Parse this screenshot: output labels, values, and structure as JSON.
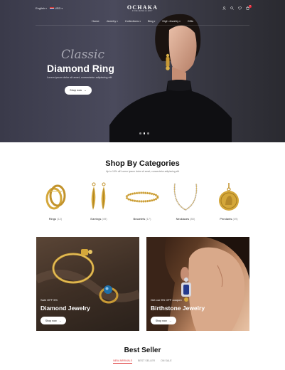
{
  "header": {
    "language": "English",
    "currency": "USD",
    "logo": "OCHAKA",
    "logo_tagline": "FINEJEWELLERY",
    "cart_count": "0",
    "nav": [
      "Home",
      "Jewelry",
      "Collections",
      "Blog",
      "High Jewelry",
      "Gifts"
    ]
  },
  "hero": {
    "script": "Classic",
    "title": "Diamond Ring",
    "subtitle": "Lorem ipsum dolor sit amet, consectetur adipiscing elit",
    "button": "Shop now",
    "slide_count": 3,
    "active_slide": 1
  },
  "categories": {
    "title": "Shop By Categories",
    "subtitle": "Up to 10% off Lorem ipsum dolor sit amet, consectetur adipiscing elit",
    "items": [
      {
        "label": "Rings",
        "count": "(12)",
        "icon": "ring-icon"
      },
      {
        "label": "Earrings",
        "count": "(49)",
        "icon": "earrings-icon"
      },
      {
        "label": "Bracelets",
        "count": "(17)",
        "icon": "bracelet-icon"
      },
      {
        "label": "Necklaces",
        "count": "(80)",
        "icon": "necklace-icon"
      },
      {
        "label": "Pendants",
        "count": "(49)",
        "icon": "pendant-icon"
      }
    ]
  },
  "banners": [
    {
      "offer": "Sale OFF 5%",
      "title": "Diamond Jewelry",
      "button": "Shop now"
    },
    {
      "offer": "Get our 5% OFF coupon",
      "title": "Birthstone Jewelry",
      "button": "Shop now"
    }
  ],
  "best_seller": {
    "title": "Best Seller",
    "tabs": [
      "NEW ARRIVALS",
      "BEST SELLER",
      "ON SALE"
    ],
    "active_tab": 0
  },
  "colors": {
    "accent": "#dd3333",
    "gold": "#d4a73a",
    "hero_bg": "#3c3c4a"
  }
}
